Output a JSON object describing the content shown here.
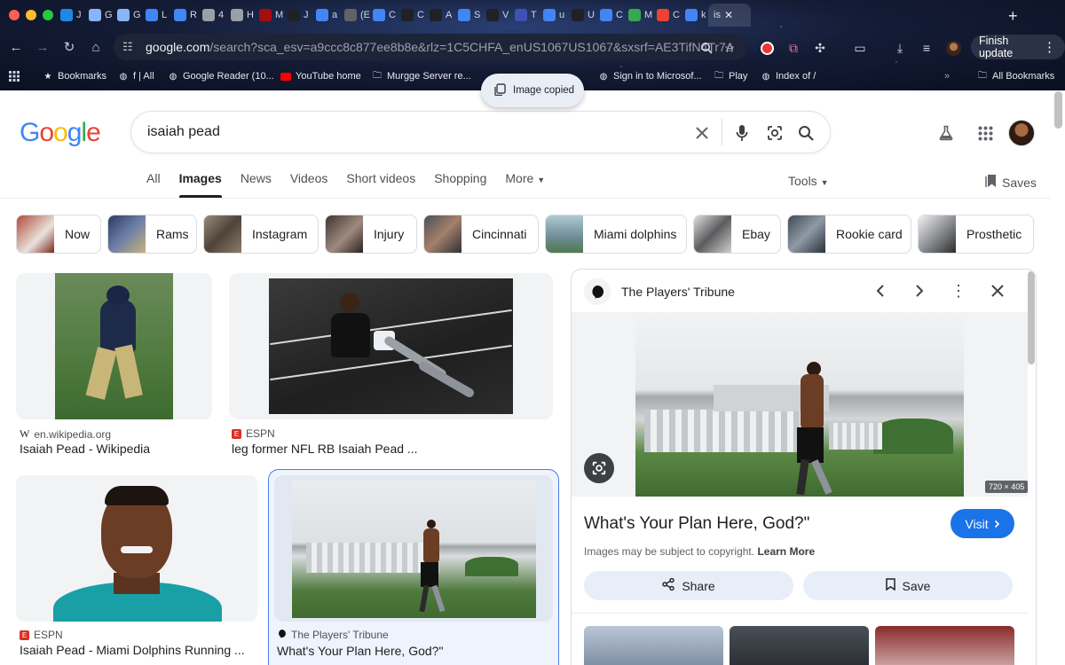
{
  "browser": {
    "tabs": [
      {
        "label": "J",
        "color": "#1e88e5"
      },
      {
        "label": "G",
        "color": "#8ab4f8"
      },
      {
        "label": "G",
        "color": "#8ab4f8"
      },
      {
        "label": "L",
        "color": "#4285f4"
      },
      {
        "label": "R",
        "color": "#4285f4"
      },
      {
        "label": "4",
        "color": "#9aa0a6"
      },
      {
        "label": "H",
        "color": "#9aa0a6"
      },
      {
        "label": "M",
        "color": "#a50e0e"
      },
      {
        "label": "J",
        "color": "#202124"
      },
      {
        "label": "a",
        "color": "#4285f4"
      },
      {
        "label": "(E",
        "color": "#5f6368"
      },
      {
        "label": "C",
        "color": "#4285f4"
      },
      {
        "label": "C",
        "color": "#202124"
      },
      {
        "label": "A",
        "color": "#202124"
      },
      {
        "label": "S",
        "color": "#4285f4"
      },
      {
        "label": "V",
        "color": "#202124"
      },
      {
        "label": "T",
        "color": "#3f51b5"
      },
      {
        "label": "u",
        "color": "#4285f4"
      },
      {
        "label": "U",
        "color": "#202124"
      },
      {
        "label": "C",
        "color": "#4285f4"
      },
      {
        "label": "M",
        "color": "#34a853"
      },
      {
        "label": "C",
        "color": "#ea4335"
      },
      {
        "label": "k",
        "color": "#4285f4"
      }
    ],
    "active_tab_label": "is",
    "url_host": "google.com",
    "url_rest": "/search?sca_esv=a9ccc8c877ee8b8e&rlz=1C5CHFA_enUS1067US1067&sxsrf=AE3TifN4Tr7AF3p...",
    "finish_update": "Finish update",
    "bookmarks": [
      {
        "label": "Bookmarks",
        "icon": "star-icon"
      },
      {
        "label": "f | All",
        "icon": "globe-icon"
      },
      {
        "label": "Google Reader (10...",
        "icon": "globe-icon"
      },
      {
        "label": "YouTube home",
        "icon": "youtube-icon"
      },
      {
        "label": "Murgge Server re...",
        "icon": "folder-icon"
      },
      {
        "label": "Sign in to Microsof...",
        "icon": "globe-icon"
      },
      {
        "label": "Play",
        "icon": "folder-icon"
      },
      {
        "label": "Index of /",
        "icon": "globe-icon"
      },
      {
        "label": "All Bookmarks",
        "icon": "folder-icon"
      }
    ],
    "toast": "Image copied"
  },
  "search": {
    "query": "isaiah pead",
    "tabs": [
      "All",
      "Images",
      "News",
      "Videos",
      "Short videos",
      "Shopping",
      "More"
    ],
    "active_tab": "Images",
    "tools": "Tools",
    "saves": "Saves"
  },
  "chips": [
    {
      "label": "Now",
      "color": "#8b3a2b"
    },
    {
      "label": "Rams",
      "color": "#2c3a5e"
    },
    {
      "label": "Instagram",
      "color": "#6b5a4b"
    },
    {
      "label": "Injury",
      "color": "#3d3431"
    },
    {
      "label": "Cincinnati",
      "color": "#4b4f58"
    },
    {
      "label": "Miami dolphins",
      "color": "#6d8b94"
    },
    {
      "label": "Ebay",
      "color": "#5b5c5e"
    },
    {
      "label": "Rookie card",
      "color": "#3e4a55"
    },
    {
      "label": "Prosthetic",
      "color": "#8f9296"
    }
  ],
  "results": [
    {
      "source": "en.wikipedia.org",
      "title": "Isaiah Pead - Wikipedia"
    },
    {
      "source": "ESPN",
      "title": "leg former NFL RB Isaiah Pead ..."
    },
    {
      "source": "ESPN",
      "title": "Isaiah Pead - Miami Dolphins Running ..."
    },
    {
      "source": "The Players' Tribune",
      "title": "What's Your Plan Here, God?\""
    }
  ],
  "panel": {
    "source": "The Players' Tribune",
    "dims": "720 × 405",
    "title": "What's Your Plan Here, God?\"",
    "visit": "Visit",
    "copyright": "Images may be subject to copyright.",
    "learn_more": "Learn More",
    "share": "Share",
    "save": "Save"
  },
  "colors": {
    "accent": "#1a73e8",
    "google_blue": "#4285f4",
    "google_red": "#ea4335",
    "google_yellow": "#fbbc05",
    "google_green": "#34a853"
  }
}
